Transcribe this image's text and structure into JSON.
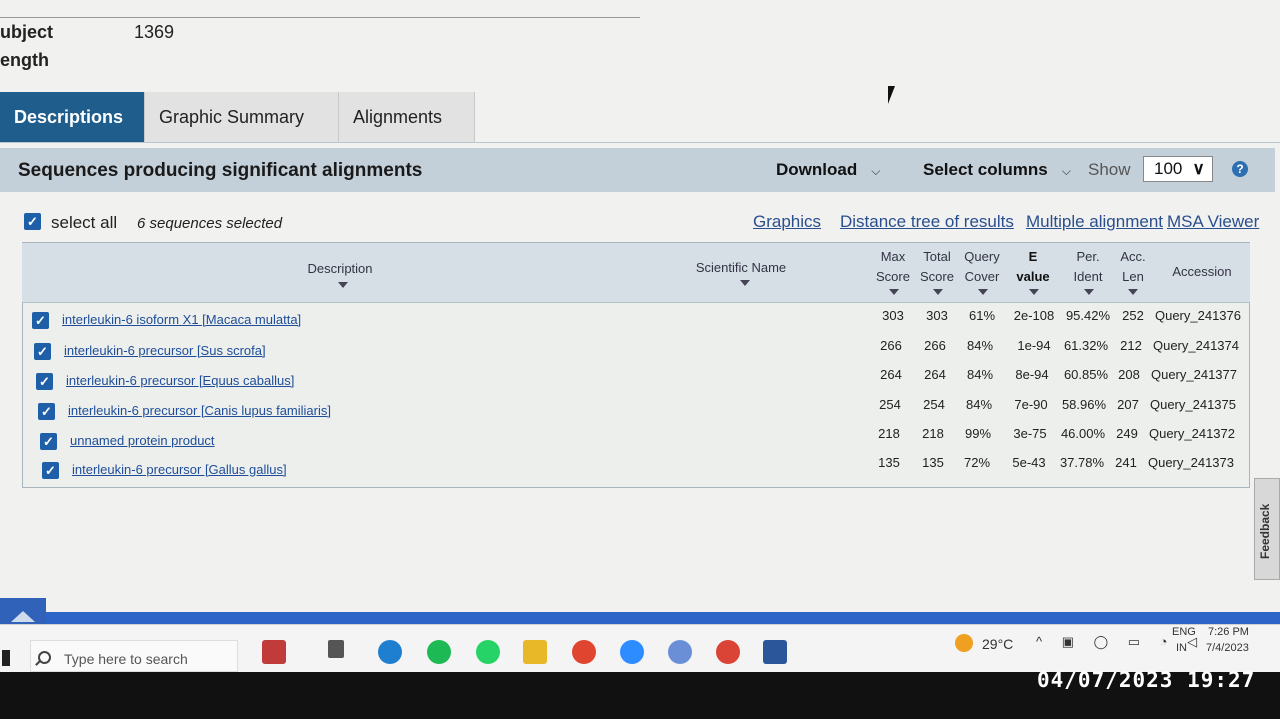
{
  "subject": {
    "label1": "ubject",
    "value1": "1369",
    "label2": "ength"
  },
  "tabs": [
    "Descriptions",
    "Graphic Summary",
    "Alignments"
  ],
  "header": {
    "title": "Sequences producing significant alignments",
    "download": "Download",
    "select_columns": "Select columns",
    "show_label": "Show",
    "show_value": "100",
    "help": "?"
  },
  "selection": {
    "select_all": "select all",
    "count": "6 sequences selected"
  },
  "tools": [
    "Graphics",
    "Distance tree of results",
    "Multiple alignment",
    "MSA Viewer"
  ],
  "columns": {
    "description": "Description",
    "scientific_name": "Scientific Name",
    "max_score": [
      "Max",
      "Score"
    ],
    "total_score": [
      "Total",
      "Score"
    ],
    "query_cover": [
      "Query",
      "Cover"
    ],
    "e_value": [
      "E",
      "value"
    ],
    "per_ident": [
      "Per.",
      "Ident"
    ],
    "acc_len": [
      "Acc.",
      "Len"
    ],
    "accession": "Accession"
  },
  "rows": [
    {
      "desc": "interleukin-6 isoform X1 [Macaca mulatta]",
      "max": "303",
      "total": "303",
      "cover": "61%",
      "e": "2e-108",
      "ident": "95.42%",
      "len": "252",
      "acc": "Query_241376"
    },
    {
      "desc": "interleukin-6 precursor [Sus scrofa]",
      "max": "266",
      "total": "266",
      "cover": "84%",
      "e": "1e-94",
      "ident": "61.32%",
      "len": "212",
      "acc": "Query_241374"
    },
    {
      "desc": "interleukin-6 precursor [Equus caballus]",
      "max": "264",
      "total": "264",
      "cover": "84%",
      "e": "8e-94",
      "ident": "60.85%",
      "len": "208",
      "acc": "Query_241377"
    },
    {
      "desc": "interleukin-6 precursor [Canis lupus familiaris]",
      "max": "254",
      "total": "254",
      "cover": "84%",
      "e": "7e-90",
      "ident": "58.96%",
      "len": "207",
      "acc": "Query_241375"
    },
    {
      "desc": "unnamed protein product",
      "max": "218",
      "total": "218",
      "cover": "99%",
      "e": "3e-75",
      "ident": "46.00%",
      "len": "249",
      "acc": "Query_241372"
    },
    {
      "desc": "interleukin-6 precursor [Gallus gallus]",
      "max": "135",
      "total": "135",
      "cover": "72%",
      "e": "5e-43",
      "ident": "37.78%",
      "len": "241",
      "acc": "Query_241373"
    }
  ],
  "feedback": "Feedback",
  "taskbar": {
    "search_placeholder": "Type here to search",
    "weather": "29°C",
    "lang1": "ENG",
    "lang2": "IN",
    "time": "7:26 PM",
    "date": "7/4/2023"
  },
  "photo_datestamp": "04/07/2023 19:27",
  "colors": {
    "accent": "#1f5e8c",
    "link": "#1f4d9a",
    "taskbar_strip": "#2d64c8"
  }
}
